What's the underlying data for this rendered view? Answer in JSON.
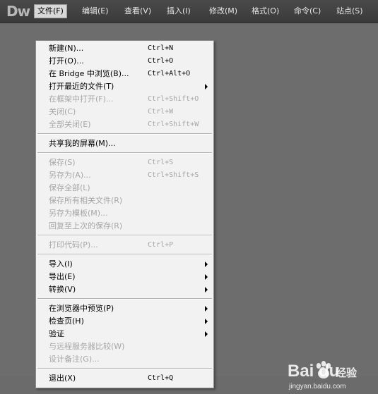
{
  "app": {
    "logo": "Dw"
  },
  "menubar": [
    {
      "label": "文件(F)",
      "active": true
    },
    {
      "label": "编辑(E)",
      "active": false
    },
    {
      "label": "查看(V)",
      "active": false
    },
    {
      "label": "插入(I)",
      "active": false
    },
    {
      "label": "修改(M)",
      "active": false
    },
    {
      "label": "格式(O)",
      "active": false
    },
    {
      "label": "命令(C)",
      "active": false
    },
    {
      "label": "站点(S)",
      "active": false
    }
  ],
  "file_menu": [
    {
      "label": "新建(N)...",
      "shortcut": "Ctrl+N",
      "enabled": true,
      "submenu": false
    },
    {
      "label": "打开(O)...",
      "shortcut": "Ctrl+O",
      "enabled": true,
      "submenu": false
    },
    {
      "label": "在 Bridge 中浏览(B)...",
      "shortcut": "Ctrl+Alt+O",
      "enabled": true,
      "submenu": false
    },
    {
      "label": "打开最近的文件(T)",
      "shortcut": "",
      "enabled": true,
      "submenu": true
    },
    {
      "label": "在框架中打开(F)...",
      "shortcut": "Ctrl+Shift+O",
      "enabled": false,
      "submenu": false
    },
    {
      "label": "关闭(C)",
      "shortcut": "Ctrl+W",
      "enabled": false,
      "submenu": false
    },
    {
      "label": "全部关闭(E)",
      "shortcut": "Ctrl+Shift+W",
      "enabled": false,
      "submenu": false
    },
    {
      "separator": true
    },
    {
      "label": "共享我的屏幕(M)...",
      "shortcut": "",
      "enabled": true,
      "submenu": false
    },
    {
      "separator": true
    },
    {
      "label": "保存(S)",
      "shortcut": "Ctrl+S",
      "enabled": false,
      "submenu": false
    },
    {
      "label": "另存为(A)...",
      "shortcut": "Ctrl+Shift+S",
      "enabled": false,
      "submenu": false
    },
    {
      "label": "保存全部(L)",
      "shortcut": "",
      "enabled": false,
      "submenu": false
    },
    {
      "label": "保存所有相关文件(R)",
      "shortcut": "",
      "enabled": false,
      "submenu": false
    },
    {
      "label": "另存为模板(M)...",
      "shortcut": "",
      "enabled": false,
      "submenu": false
    },
    {
      "label": "回复至上次的保存(R)",
      "shortcut": "",
      "enabled": false,
      "submenu": false
    },
    {
      "separator": true
    },
    {
      "label": "打印代码(P)...",
      "shortcut": "Ctrl+P",
      "enabled": false,
      "submenu": false
    },
    {
      "separator": true
    },
    {
      "label": "导入(I)",
      "shortcut": "",
      "enabled": true,
      "submenu": true
    },
    {
      "label": "导出(E)",
      "shortcut": "",
      "enabled": true,
      "submenu": true
    },
    {
      "label": "转换(V)",
      "shortcut": "",
      "enabled": true,
      "submenu": true
    },
    {
      "separator": true
    },
    {
      "label": "在浏览器中预览(P)",
      "shortcut": "",
      "enabled": true,
      "submenu": true
    },
    {
      "label": "检查页(H)",
      "shortcut": "",
      "enabled": true,
      "submenu": true
    },
    {
      "label": "验证",
      "shortcut": "",
      "enabled": true,
      "submenu": true
    },
    {
      "label": "与远程服务器比较(W)",
      "shortcut": "",
      "enabled": false,
      "submenu": false
    },
    {
      "label": "设计备注(G)...",
      "shortcut": "",
      "enabled": false,
      "submenu": false
    },
    {
      "separator": true
    },
    {
      "label": "退出(X)",
      "shortcut": "Ctrl+Q",
      "enabled": true,
      "submenu": false
    }
  ],
  "watermark": {
    "brand": "Bai  du",
    "text": "经验",
    "url": "jingyan.baidu.com"
  }
}
